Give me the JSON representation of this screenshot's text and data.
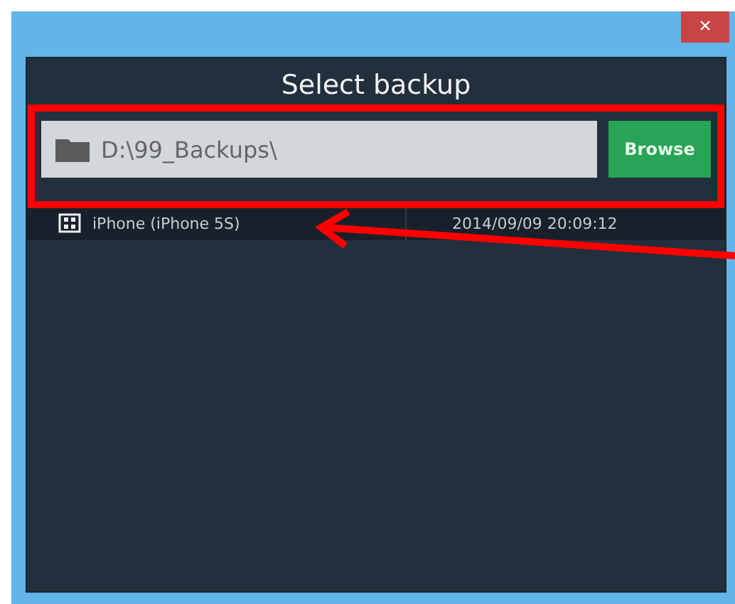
{
  "window": {
    "close": "×"
  },
  "dialog": {
    "title": "Select backup",
    "path_field": {
      "value": "D:\\99_Backups\\"
    },
    "browse_button": "Browse"
  },
  "backups": [
    {
      "device": "iPhone (iPhone 5S)",
      "date": "2014/09/09 20:09:12",
      "selected": true
    }
  ]
}
